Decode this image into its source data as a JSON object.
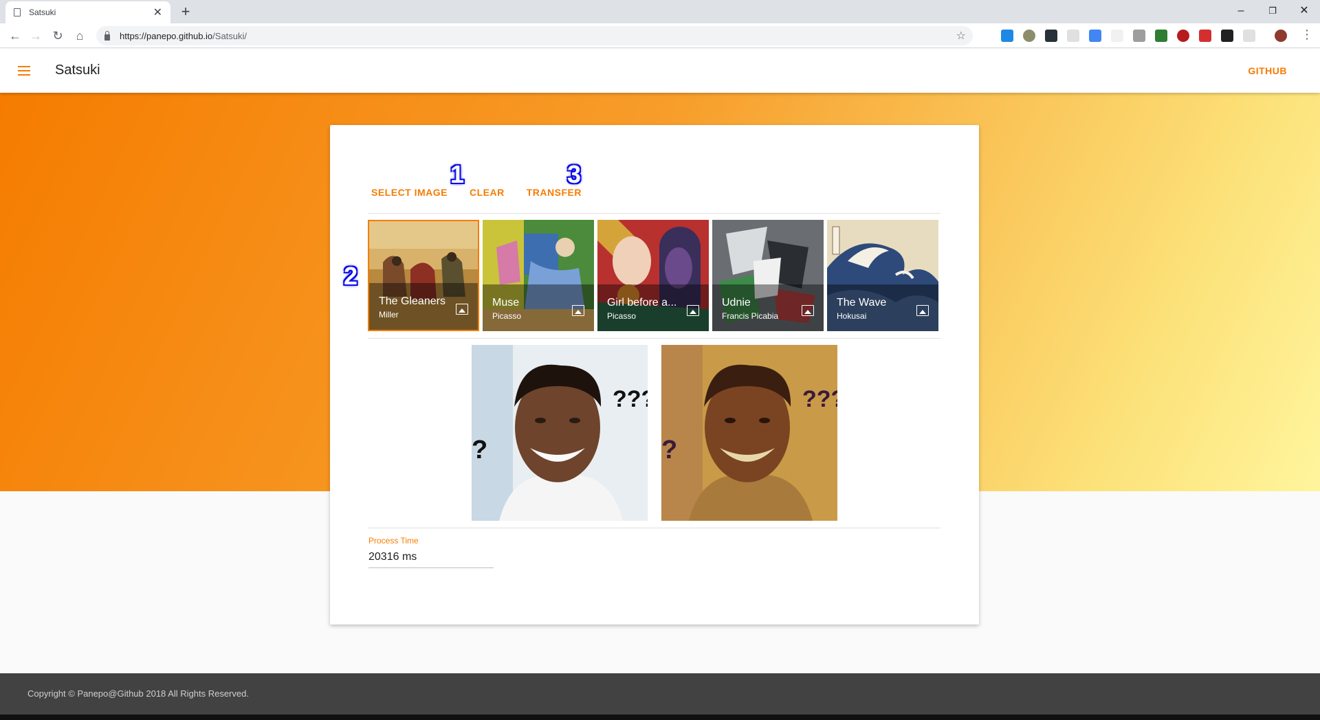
{
  "browser": {
    "tab_title": "Satsuki",
    "url_host": "https://panepo.github.io",
    "url_path": "/Satsuki/"
  },
  "appbar": {
    "title": "Satsuki",
    "github_label": "GITHUB"
  },
  "actions": {
    "select_image": "SELECT IMAGE",
    "clear": "CLEAR",
    "transfer": "TRANSFER"
  },
  "badges": [
    "1",
    "2",
    "3"
  ],
  "styles": [
    {
      "name": "The Gleaners",
      "author": "Miller",
      "selected": true
    },
    {
      "name": "Muse",
      "author": "Picasso",
      "selected": false
    },
    {
      "name": "Girl before a...",
      "author": "Picasso",
      "selected": false
    },
    {
      "name": "Udnie",
      "author": "Francis Picabia",
      "selected": false
    },
    {
      "name": "The Wave",
      "author": "Hokusai",
      "selected": false
    }
  ],
  "images": {
    "input_text_a": "???",
    "input_text_b": "?",
    "output_text_a": "???",
    "output_text_b": "?"
  },
  "process": {
    "label": "Process Time",
    "value": "20316 ms"
  },
  "footer": {
    "copyright": "Copyright © Panepo@Github 2018 All Rights Reserved."
  },
  "colors": {
    "accent": "#f57c00",
    "footer_bg": "#424242"
  }
}
